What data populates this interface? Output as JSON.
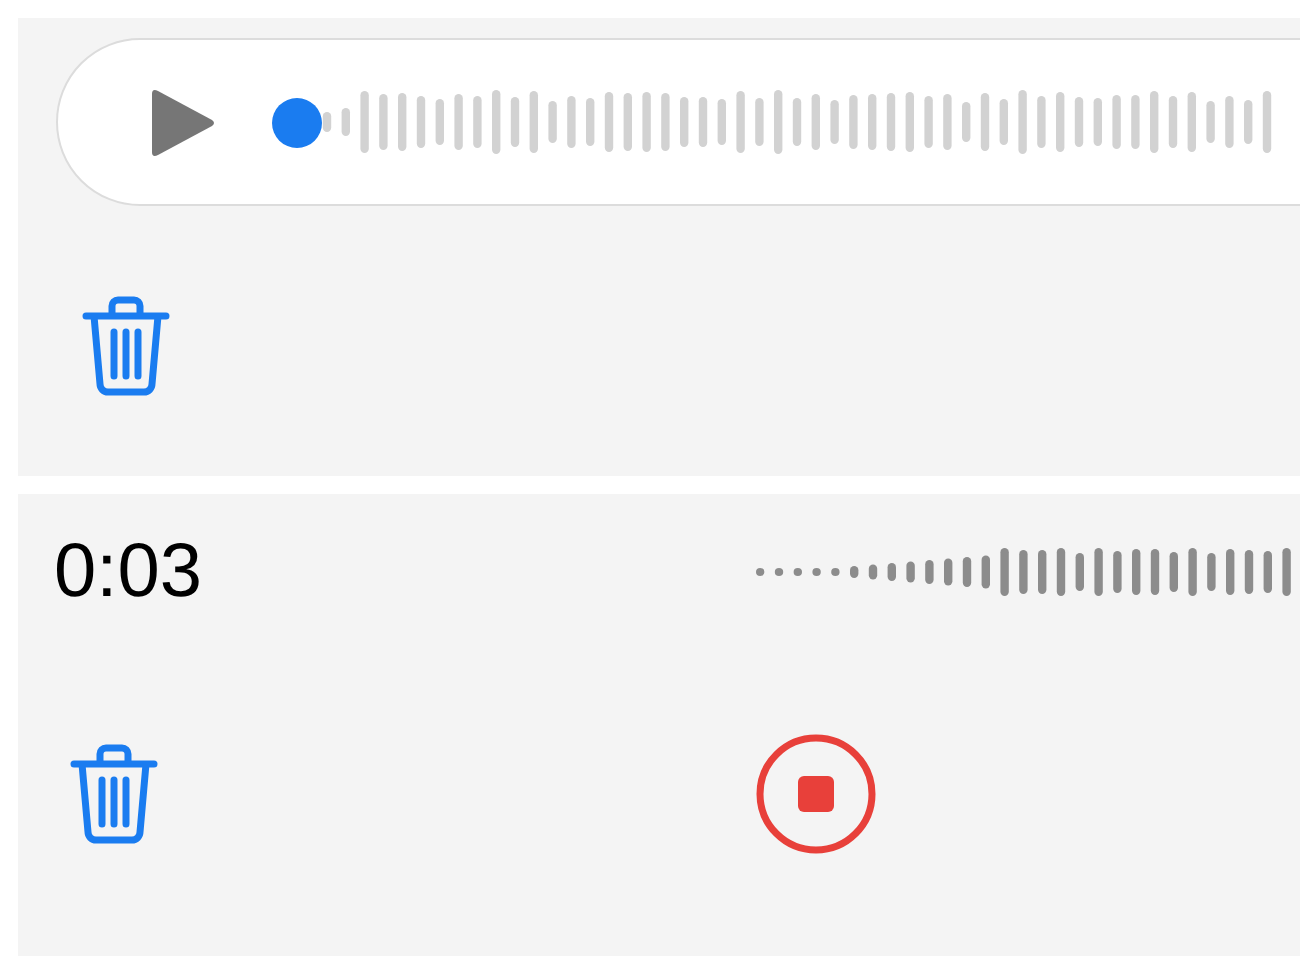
{
  "player": {
    "level": 0
  },
  "recording": {
    "elapsed": "0:03"
  }
}
